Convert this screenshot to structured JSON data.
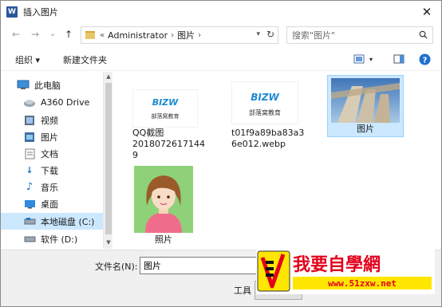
{
  "window": {
    "title": "插入图片",
    "app_icon": "W"
  },
  "nav": {
    "back": "←",
    "forward": "→",
    "dropdown": "⌄",
    "up": "↑"
  },
  "address": {
    "root_chevron": "«",
    "crumbs": [
      "Administrator",
      "图片"
    ],
    "separator": "›"
  },
  "search": {
    "placeholder": "搜索\"图片\""
  },
  "toolbar": {
    "organize": "组织 ▾",
    "new_folder": "新建文件夹"
  },
  "sidebar": {
    "items": [
      {
        "label": "此电脑",
        "icon": "computer-icon"
      },
      {
        "label": "A360 Drive",
        "icon": "cloud-drive-icon"
      },
      {
        "label": "视频",
        "icon": "video-folder-icon"
      },
      {
        "label": "图片",
        "icon": "pictures-folder-icon"
      },
      {
        "label": "文档",
        "icon": "documents-folder-icon"
      },
      {
        "label": "下载",
        "icon": "download-icon"
      },
      {
        "label": "音乐",
        "icon": "music-icon"
      },
      {
        "label": "桌面",
        "icon": "desktop-icon"
      },
      {
        "label": "本地磁盘 (C:)",
        "icon": "disk-icon",
        "selected": true
      },
      {
        "label": "软件 (D:)",
        "icon": "disk-icon"
      }
    ]
  },
  "files": [
    {
      "name": "QQ截图20180726171449",
      "lines": [
        "QQ截图",
        "2018072617144",
        "9"
      ],
      "kind": "logo"
    },
    {
      "name": "t01f9a89ba83a36e012.webp",
      "lines": [
        "t01f9a89ba83a3",
        "6e012.webp"
      ],
      "kind": "logo"
    },
    {
      "name": "图片",
      "lines": [
        "图片"
      ],
      "kind": "columns",
      "selected": true
    },
    {
      "name": "照片",
      "lines": [
        "照片"
      ],
      "kind": "portrait"
    }
  ],
  "logo_text": {
    "brand": "BIZW",
    "cn": "部落窝教育"
  },
  "bottom": {
    "filename_label": "文件名(N):",
    "filename_value": "图片",
    "tools_label": "工具"
  },
  "watermark": {
    "text": "我要自學網",
    "url": "www.51zxw.net"
  },
  "colors": {
    "selection": "#cce8ff",
    "accent": "#0078d7",
    "watermark_red": "#e3001b",
    "watermark_yellow": "#ffe600"
  }
}
